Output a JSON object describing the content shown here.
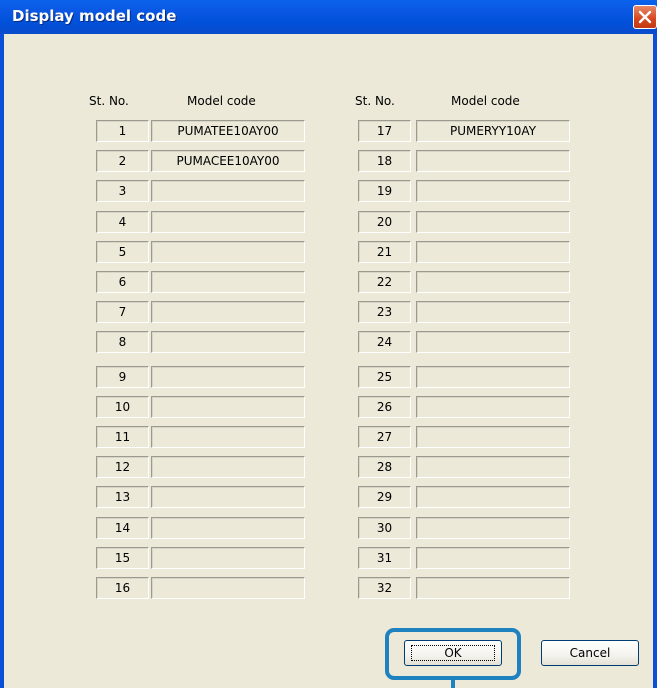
{
  "window": {
    "title": "Display model code"
  },
  "headers": {
    "left_st_no": "St. No.",
    "left_model_code": "Model code",
    "right_st_no": "St. No.",
    "right_model_code": "Model code"
  },
  "left_rows": [
    {
      "st": "1",
      "code": "PUMATEE10AY00"
    },
    {
      "st": "2",
      "code": "PUMACEE10AY00"
    },
    {
      "st": "3",
      "code": ""
    },
    {
      "st": "4",
      "code": ""
    },
    {
      "st": "5",
      "code": ""
    },
    {
      "st": "6",
      "code": ""
    },
    {
      "st": "7",
      "code": ""
    },
    {
      "st": "8",
      "code": ""
    },
    {
      "st": "9",
      "code": ""
    },
    {
      "st": "10",
      "code": ""
    },
    {
      "st": "11",
      "code": ""
    },
    {
      "st": "12",
      "code": ""
    },
    {
      "st": "13",
      "code": ""
    },
    {
      "st": "14",
      "code": ""
    },
    {
      "st": "15",
      "code": ""
    },
    {
      "st": "16",
      "code": ""
    }
  ],
  "right_rows": [
    {
      "st": "17",
      "code": "PUMERYY10AY"
    },
    {
      "st": "18",
      "code": ""
    },
    {
      "st": "19",
      "code": ""
    },
    {
      "st": "20",
      "code": ""
    },
    {
      "st": "21",
      "code": ""
    },
    {
      "st": "22",
      "code": ""
    },
    {
      "st": "23",
      "code": ""
    },
    {
      "st": "24",
      "code": ""
    },
    {
      "st": "25",
      "code": ""
    },
    {
      "st": "26",
      "code": ""
    },
    {
      "st": "27",
      "code": ""
    },
    {
      "st": "28",
      "code": ""
    },
    {
      "st": "29",
      "code": ""
    },
    {
      "st": "30",
      "code": ""
    },
    {
      "st": "31",
      "code": ""
    },
    {
      "st": "32",
      "code": ""
    }
  ],
  "buttons": {
    "ok": "OK",
    "cancel": "Cancel"
  },
  "icons": {
    "close": "close-icon"
  },
  "colors": {
    "titlebar": "#0a58e4",
    "dialog_bg": "#ece9d8",
    "highlight": "#1f82c0",
    "close": "#d6451f"
  }
}
